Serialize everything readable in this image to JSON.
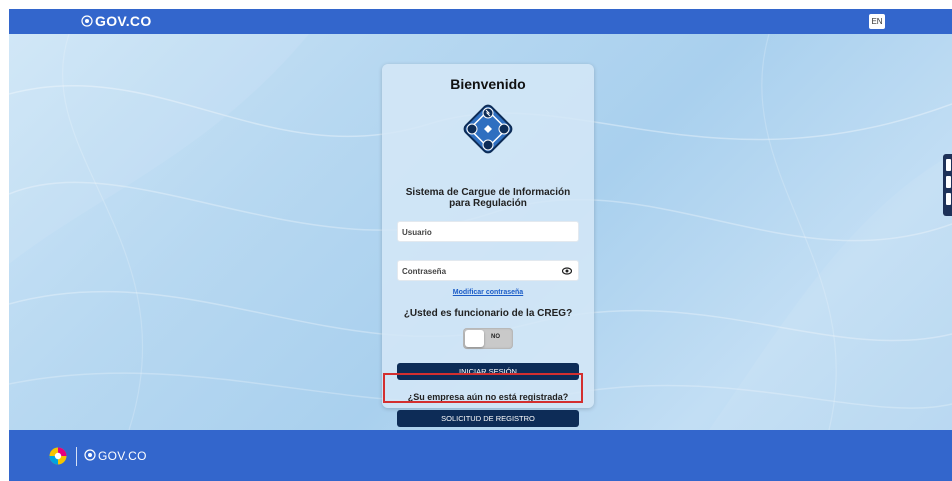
{
  "topbar": {
    "brand": "GOV.CO",
    "lang_button": "EN"
  },
  "login": {
    "title": "Bienvenido",
    "subtitle_line1": "Sistema de Cargue de Información",
    "subtitle_line2": "para Regulación",
    "username_placeholder": "Usuario",
    "password_placeholder": "Contraseña",
    "forgot_link": "Modificar contraseña",
    "creg_question": "¿Usted es funcionario de la CREG?",
    "toggle_state": "NO",
    "login_button": "INICIAR SESIÓN",
    "register_question": "¿Su empresa aún no está registrada?",
    "register_button": "SOLICITUD DE REGISTRO"
  },
  "footer": {
    "brand": "GOV.CO"
  },
  "colors": {
    "gov_blue": "#3366cc",
    "navy": "#0d2c57",
    "highlight": "#d32f2f",
    "link": "#1b5cc7"
  }
}
